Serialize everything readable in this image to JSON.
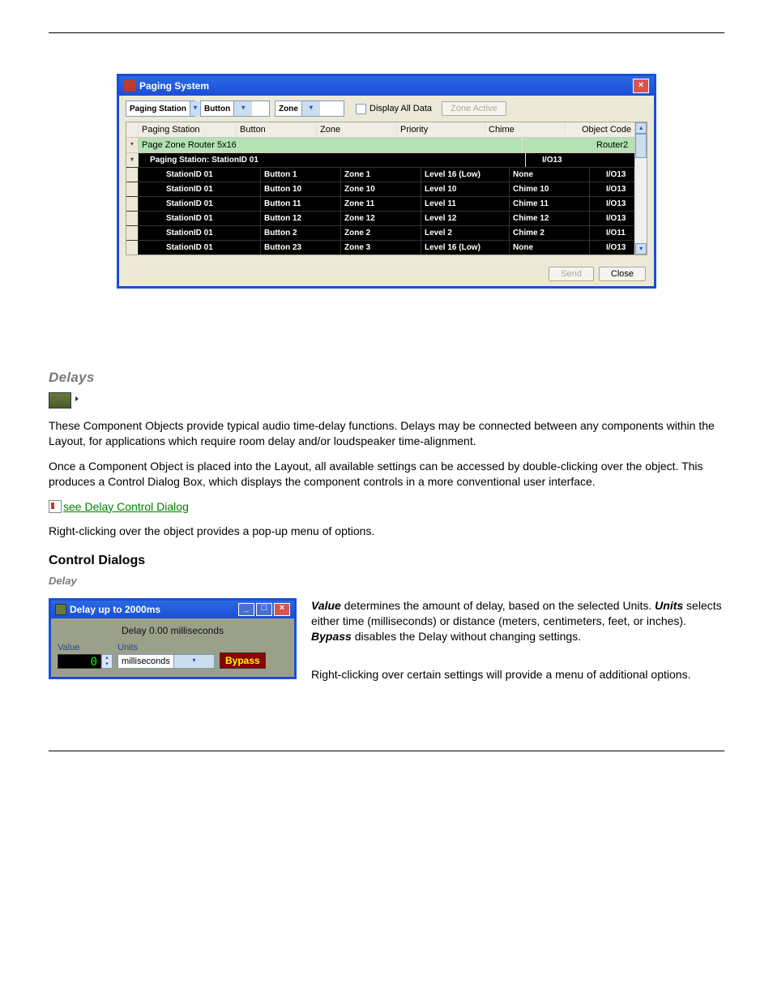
{
  "paging_window": {
    "title": "Paging System",
    "toolbar": {
      "dd_station": "Paging Station",
      "dd_button": "Button",
      "dd_zone": "Zone",
      "chk_display_all": "Display All Data",
      "btn_zone_active": "Zone Active"
    },
    "columns": [
      "Paging Station",
      "Button",
      "Zone",
      "Priority",
      "Chime",
      "Object Code"
    ],
    "pzr_row": {
      "label": "Page Zone Router  5x16",
      "code": "Router2"
    },
    "group_header": {
      "label": "Paging Station: StationID 01",
      "code": "I/O13"
    },
    "rows": [
      {
        "station": "StationID 01",
        "button": "Button 1",
        "zone": "Zone 1",
        "priority": "Level 16 (Low)",
        "chime": "None",
        "code": "I/O13"
      },
      {
        "station": "StationID 01",
        "button": "Button 10",
        "zone": "Zone 10",
        "priority": "Level 10",
        "chime": "Chime 10",
        "code": "I/O13"
      },
      {
        "station": "StationID 01",
        "button": "Button 11",
        "zone": "Zone 11",
        "priority": "Level 11",
        "chime": "Chime 11",
        "code": "I/O13"
      },
      {
        "station": "StationID 01",
        "button": "Button 12",
        "zone": "Zone 12",
        "priority": "Level 12",
        "chime": "Chime 12",
        "code": "I/O13"
      },
      {
        "station": "StationID 01",
        "button": "Button 2",
        "zone": "Zone 2",
        "priority": "Level 2",
        "chime": "Chime 2",
        "code": "I/O11"
      },
      {
        "station": "StationID 01",
        "button": "Button 23",
        "zone": "Zone 3",
        "priority": "Level 16 (Low)",
        "chime": "None",
        "code": "I/O13"
      }
    ],
    "footer": {
      "send": "Send",
      "close": "Close"
    }
  },
  "delays": {
    "heading": "Delays",
    "para1": "These Component Objects provide typical audio time-delay functions. Delays may be connected between any components within the Layout, for applications which require room delay and/or loudspeaker time-alignment.",
    "para2": "Once a Component Object is placed into the Layout, all available settings can be accessed by double-clicking over the object. This produces a Control Dialog Box, which displays the component controls in a more conventional user interface.",
    "link": "see Delay Control Dialog",
    "para3": "Right-clicking over the object provides a pop-up menu of options.",
    "cd_heading": "Control Dialogs",
    "cd_sub": "Delay"
  },
  "delay_dialog": {
    "title": "Delay up to 2000ms",
    "label": "Delay 0.00 milliseconds",
    "value_hdr": "Value",
    "value": "0",
    "units_hdr": "Units",
    "units_value": "milliseconds",
    "bypass": "Bypass"
  },
  "desc": {
    "t_value": "Value",
    "s1": " determines the amount of delay, based on the selected Units. ",
    "t_units": "Units",
    "s2": " selects either time (milliseconds) or distance (meters, centimeters, feet, or inches). ",
    "t_bypass": "Bypass",
    "s3": " disables the Delay without changing settings.",
    "p2": "Right-clicking over certain settings will provide a menu of additional options."
  }
}
